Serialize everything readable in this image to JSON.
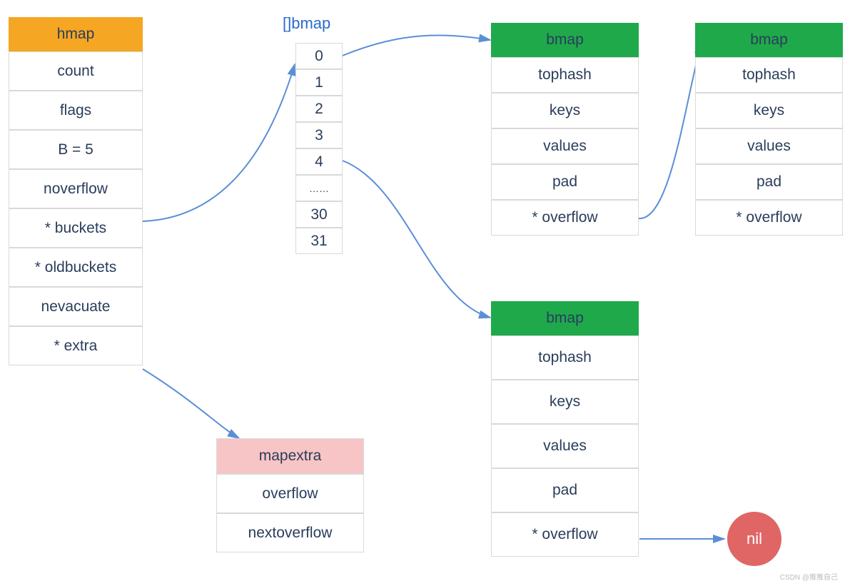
{
  "hmap": {
    "header": "hmap",
    "rows": [
      "count",
      "flags",
      "B = 5",
      "noverflow",
      "* buckets",
      "* oldbuckets",
      "nevacuate",
      "* extra"
    ]
  },
  "array": {
    "label": "[]bmap",
    "cells": [
      "0",
      "1",
      "2",
      "3",
      "4",
      "……",
      "30",
      "31"
    ]
  },
  "bmap1": {
    "header": "bmap",
    "rows": [
      "tophash",
      "keys",
      "values",
      "pad",
      "* overflow"
    ]
  },
  "bmap2": {
    "header": "bmap",
    "rows": [
      "tophash",
      "keys",
      "values",
      "pad",
      "* overflow"
    ]
  },
  "bmap3": {
    "header": "bmap",
    "rows": [
      "tophash",
      "keys",
      "values",
      "pad",
      "* overflow"
    ]
  },
  "mapextra": {
    "header": "mapextra",
    "rows": [
      "overflow",
      "nextoverflow"
    ]
  },
  "nil": {
    "label": "nil"
  },
  "watermark": "CSDN @推推自己",
  "colors": {
    "orange": "#f5a623",
    "green": "#1fa94b",
    "pink": "#f7c5c5",
    "red": "#e06666",
    "text": "#2a3d5a",
    "arrow": "#5a8fd6"
  }
}
